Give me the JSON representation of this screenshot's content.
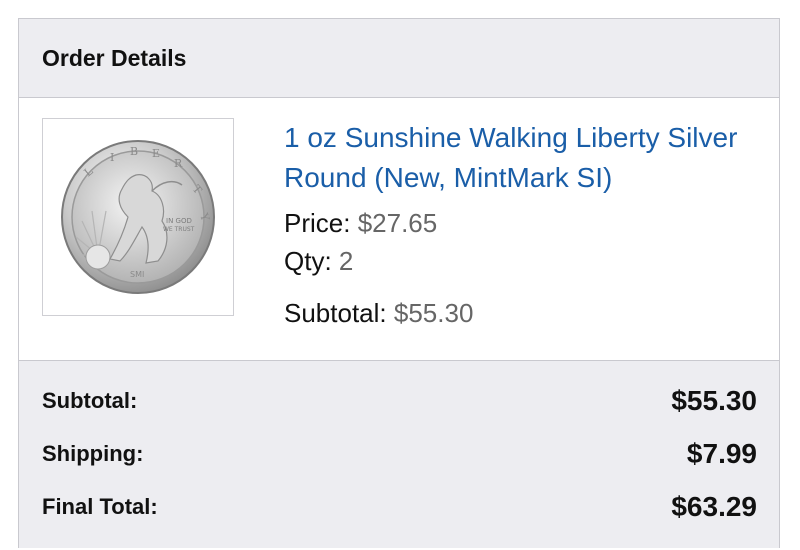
{
  "header": {
    "title": "Order Details"
  },
  "item": {
    "name": "1 oz Sunshine Walking Liberty Silver Round (New, MintMark SI)",
    "image_alt": "Silver round coin",
    "price_label": "Price:",
    "price_value": "$27.65",
    "qty_label": "Qty:",
    "qty_value": "2",
    "subtotal_label": "Subtotal:",
    "subtotal_value": "$55.30"
  },
  "totals": {
    "subtotal_label": "Subtotal:",
    "subtotal_value": "$55.30",
    "shipping_label": "Shipping:",
    "shipping_value": "$7.99",
    "final_label": "Final Total:",
    "final_value": "$63.29"
  },
  "colors": {
    "link": "#1a5ea8",
    "panel_bg": "#ededf1",
    "border": "#c9c9cf"
  }
}
